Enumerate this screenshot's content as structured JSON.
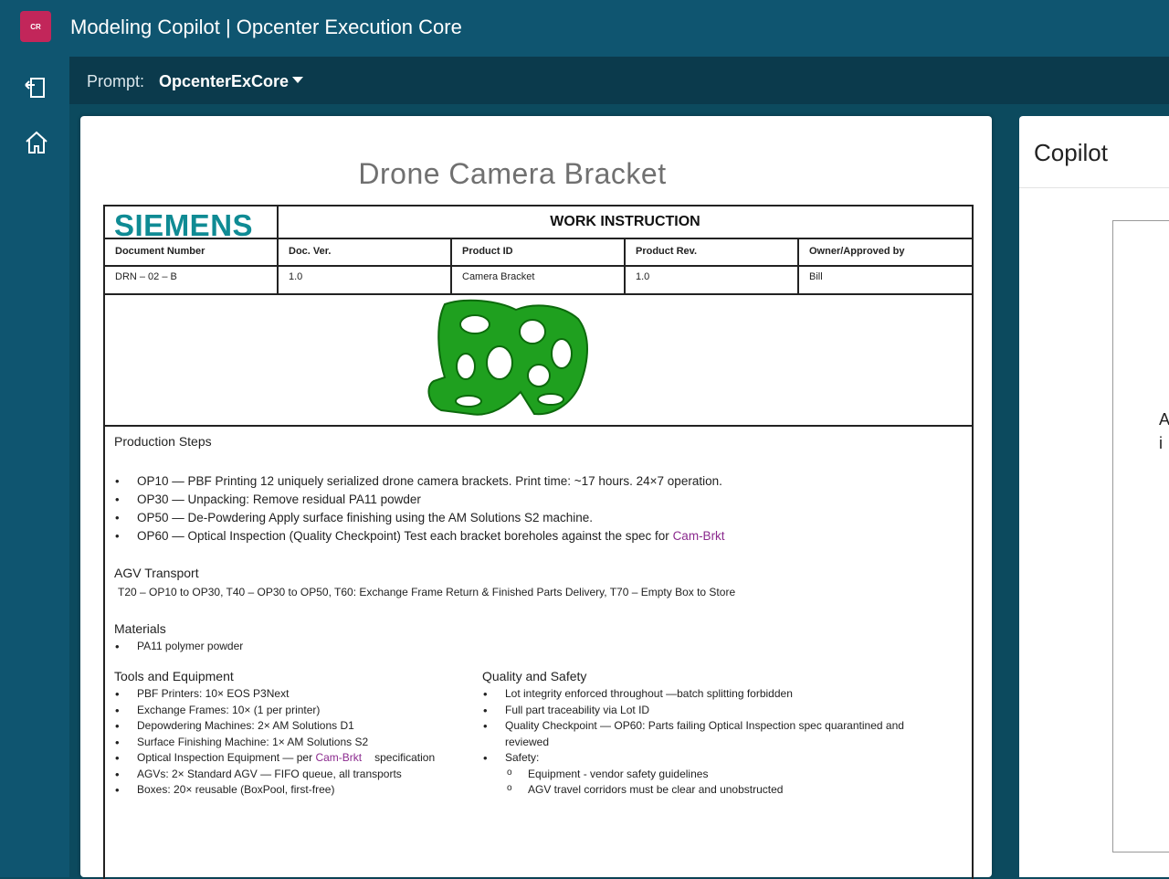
{
  "app": {
    "logo_text": "CR",
    "title": "Modeling Copilot | Opcenter Execution Core"
  },
  "rail": {
    "icons": [
      "exit-icon",
      "home-icon"
    ]
  },
  "prompt": {
    "label": "Prompt:",
    "value": "OpcenterExCore"
  },
  "document": {
    "title": "Drone Camera Bracket",
    "brand": "SIEMENS",
    "heading": "WORK INSTRUCTION",
    "columns": [
      "Document Number",
      "Doc. Ver.",
      "Product ID",
      "Product Rev.",
      "Owner/Approved by"
    ],
    "values": [
      "DRN – 02 – B",
      "1.0",
      "Camera Bracket",
      "1.0",
      "Bill"
    ],
    "production_steps": {
      "heading": "Production Steps",
      "items": [
        "OP10 — PBF Printing 12 uniquely serialized drone camera brackets. Print time: ~17 hours. 24×7 operation.",
        "OP30 — Unpacking: Remove residual PA11 powder",
        "OP50 — De-Powdering Apply surface finishing using the AM Solutions S2 machine.",
        "OP60 — Optical Inspection (Quality Checkpoint) Test each bracket boreholes against the spec for "
      ],
      "link": "Cam-Brkt"
    },
    "agv": {
      "heading": "AGV Transport",
      "text": "T20 – OP10 to OP30, T40 – OP30 to OP50, T60: Exchange Frame Return & Finished Parts Delivery, T70 – Empty Box to Store"
    },
    "materials": {
      "heading": "Materials",
      "items": [
        "PA11 polymer powder"
      ]
    },
    "tools": {
      "heading": "Tools and Equipment",
      "items": [
        "PBF Printers: 10× EOS P3Next",
        "Exchange Frames: 10× (1 per printer)",
        "Depowdering Machines: 2× AM Solutions D1",
        "Surface Finishing Machine: 1× AM Solutions S2",
        "Optical Inspection Equipment — per ",
        "AGVs: 2× Standard AGV — FIFO queue, all transports",
        "Boxes: 20× reusable (BoxPool, first-free)"
      ],
      "link": "Cam-Brkt",
      "link_suffix": "specification"
    },
    "quality": {
      "heading": "Quality and Safety",
      "items": [
        "Lot integrity enforced throughout —batch splitting forbidden",
        "Full part traceability via Lot ID",
        "Quality Checkpoint — OP60:  Parts failing Optical Inspection spec quarantined and",
        "reviewed",
        "Safety:"
      ],
      "sub_items": [
        "Equipment -  vendor safety guidelines",
        "AGV travel corridors must be clear and unobstructed"
      ]
    }
  },
  "copilot": {
    "title": "Copilot",
    "fragment_1": "A",
    "fragment_2": "i"
  },
  "colors": {
    "header": "#0f5570",
    "prompt_bar": "#0b3a4c",
    "logo": "#c2265a",
    "siemens": "#0f8b94",
    "link": "#8b2a8e",
    "part": "#1fa01f"
  }
}
